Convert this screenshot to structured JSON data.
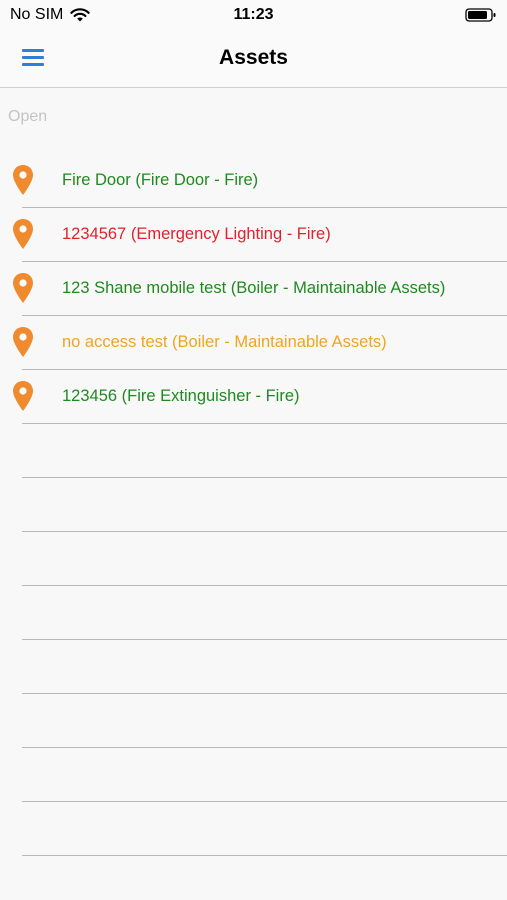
{
  "status_bar": {
    "carrier": "No SIM",
    "time": "11:23",
    "wifi_icon": "wifi-icon",
    "battery_icon": "battery-icon"
  },
  "nav": {
    "title": "Assets",
    "menu_icon": "hamburger-menu-icon",
    "accent_color": "#2f7fd8"
  },
  "section": {
    "label": "Open"
  },
  "assets": [
    {
      "label": "Fire Door (Fire Door - Fire)",
      "color": "#1f8a1f",
      "icon": "map-pin-icon"
    },
    {
      "label": "1234567 (Emergency Lighting - Fire)",
      "color": "#e0232a",
      "icon": "map-pin-icon"
    },
    {
      "label": "123 Shane mobile test (Boiler - Maintainable Assets)",
      "color": "#1f8a1f",
      "icon": "map-pin-icon"
    },
    {
      "label": "no access test (Boiler - Maintainable Assets)",
      "color": "#f2a41e",
      "icon": "map-pin-icon"
    },
    {
      "label": "123456 (Fire Extinguisher - Fire)",
      "color": "#1f8a1f",
      "icon": "map-pin-icon"
    }
  ],
  "pin_color": "#f08a2e",
  "empty_row_count": 8
}
